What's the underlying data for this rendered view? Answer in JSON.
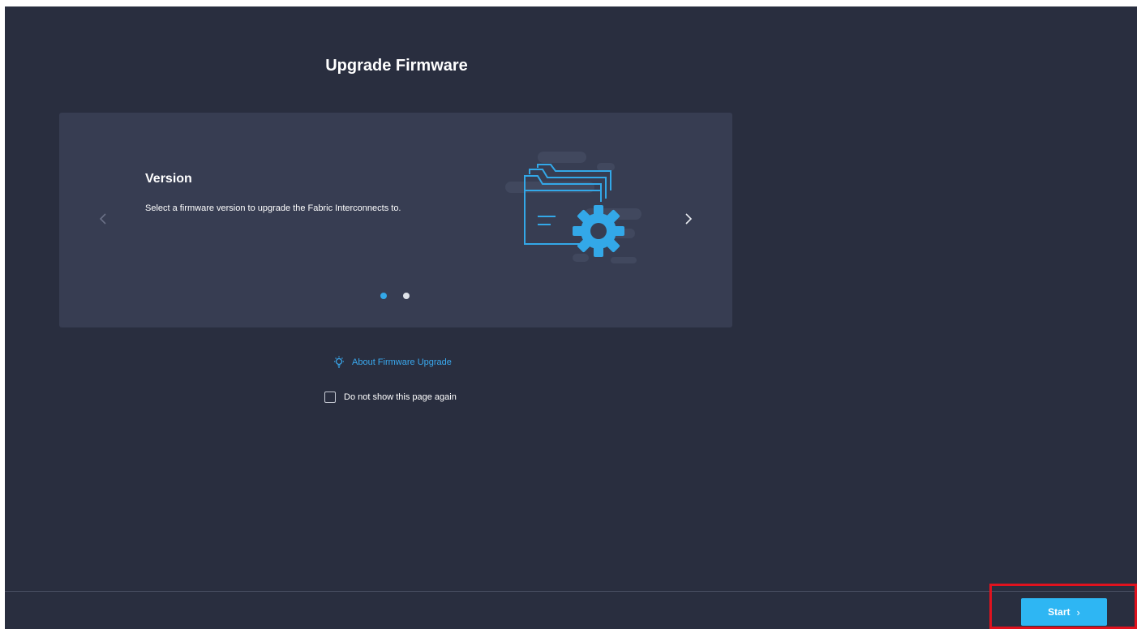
{
  "page": {
    "title": "Upgrade Firmware"
  },
  "carousel": {
    "slide_title": "Version",
    "slide_description": "Select a firmware version to upgrade the Fabric Interconnects to.",
    "prev_icon": "chevron-left-icon",
    "next_icon": "chevron-right-icon",
    "illustration_icon": "folder-gear-icon",
    "total_slides": 2,
    "active_slide": 1
  },
  "help": {
    "about_label": "About Firmware Upgrade",
    "icon": "lightbulb-icon"
  },
  "options": {
    "dont_show_label": "Do not show this page again",
    "dont_show_checked": false
  },
  "footer": {
    "start_label": "Start",
    "start_arrow": "›"
  },
  "colors": {
    "background": "#292e3f",
    "card": "#373d52",
    "accent": "#2eb6f3",
    "link": "#3aaaf0",
    "highlight": "#e0121e"
  }
}
